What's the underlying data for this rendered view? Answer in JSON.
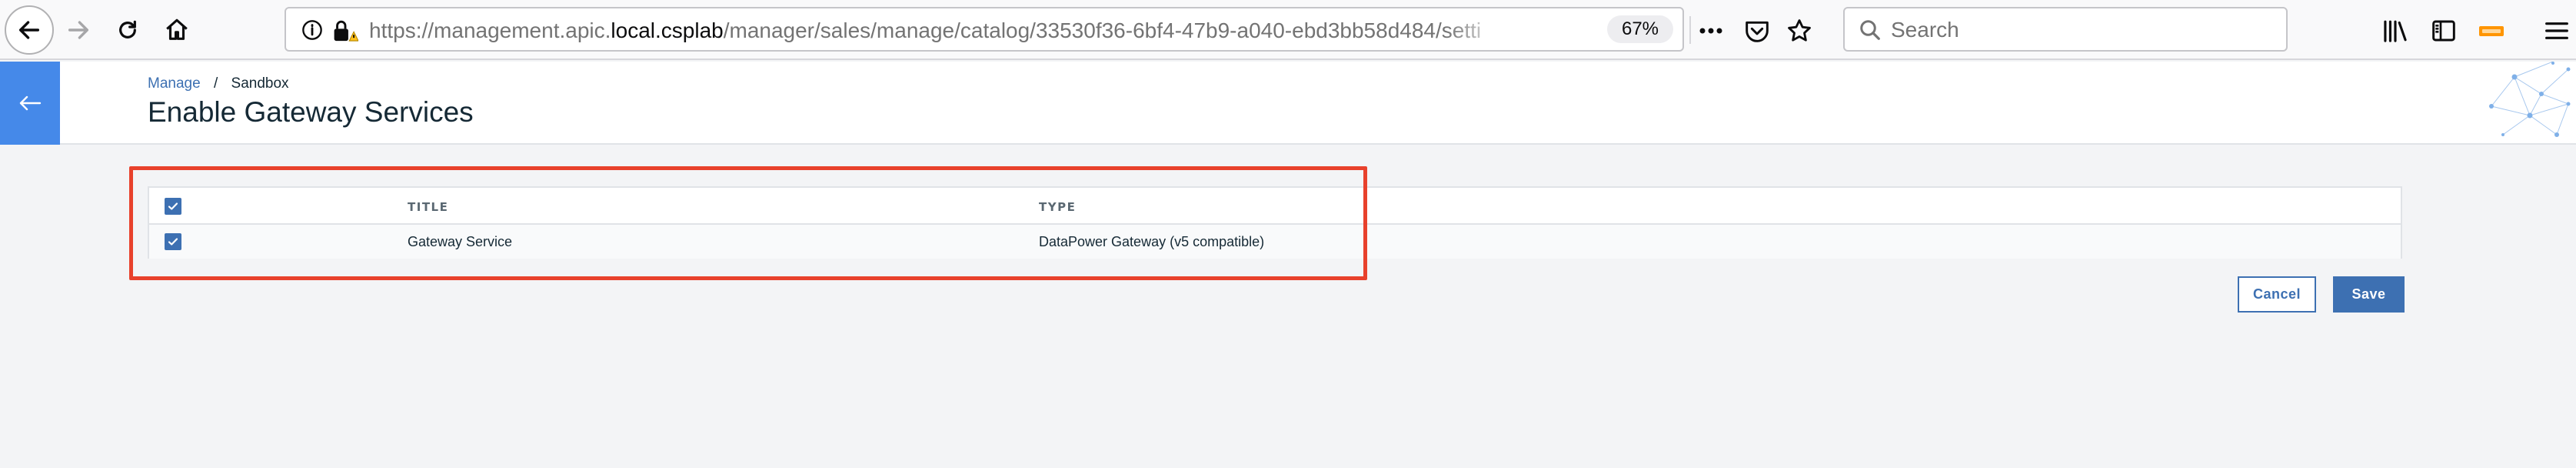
{
  "browser": {
    "url_prefix": "https://management.apic.",
    "url_host": "local.csplab",
    "url_path": "/manager/sales/manage/catalog/33530f36-6bf4-47b9-a040-ebd3bb58d484/setti",
    "zoom": "67%",
    "search_placeholder": "Search",
    "icons": [
      "back-icon",
      "forward-icon",
      "reload-icon",
      "home-icon",
      "info-icon",
      "insecure-lock-icon",
      "more-icon",
      "pocket-icon",
      "bookmark-star-icon",
      "search-icon",
      "library-icon",
      "sidebar-icon",
      "extension-icon",
      "menu-icon"
    ]
  },
  "header": {
    "breadcrumb": {
      "parent": "Manage",
      "separator": "/",
      "current": "Sandbox"
    },
    "title": "Enable Gateway Services",
    "accent_color": "#4589e9"
  },
  "table": {
    "columns": [
      "TITLE",
      "TYPE"
    ],
    "header_checked": true,
    "rows": [
      {
        "checked": true,
        "title": "Gateway Service",
        "type": "DataPower Gateway (v5 compatible)"
      }
    ]
  },
  "actions": {
    "cancel": "Cancel",
    "save": "Save"
  },
  "colors": {
    "primary": "#3d70b2",
    "highlight": "#e8412c",
    "text": "#152935"
  }
}
